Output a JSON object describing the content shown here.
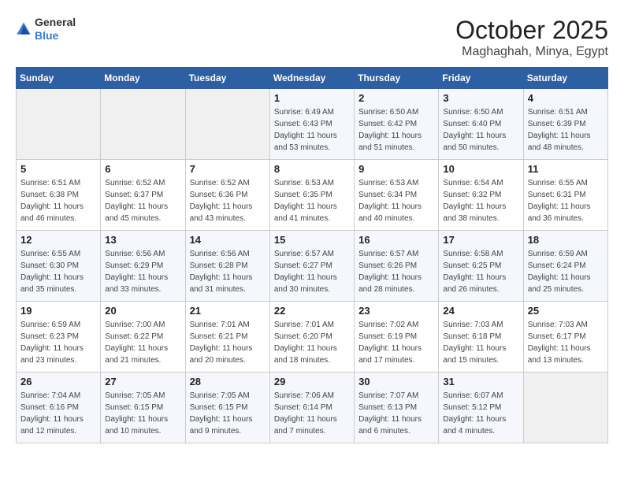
{
  "logo": {
    "text_general": "General",
    "text_blue": "Blue"
  },
  "title": {
    "month": "October 2025",
    "location": "Maghaghah, Minya, Egypt"
  },
  "days_of_week": [
    "Sunday",
    "Monday",
    "Tuesday",
    "Wednesday",
    "Thursday",
    "Friday",
    "Saturday"
  ],
  "weeks": [
    [
      {
        "day": "",
        "info": ""
      },
      {
        "day": "",
        "info": ""
      },
      {
        "day": "",
        "info": ""
      },
      {
        "day": "1",
        "info": "Sunrise: 6:49 AM\nSunset: 6:43 PM\nDaylight: 11 hours\nand 53 minutes."
      },
      {
        "day": "2",
        "info": "Sunrise: 6:50 AM\nSunset: 6:42 PM\nDaylight: 11 hours\nand 51 minutes."
      },
      {
        "day": "3",
        "info": "Sunrise: 6:50 AM\nSunset: 6:40 PM\nDaylight: 11 hours\nand 50 minutes."
      },
      {
        "day": "4",
        "info": "Sunrise: 6:51 AM\nSunset: 6:39 PM\nDaylight: 11 hours\nand 48 minutes."
      }
    ],
    [
      {
        "day": "5",
        "info": "Sunrise: 6:51 AM\nSunset: 6:38 PM\nDaylight: 11 hours\nand 46 minutes."
      },
      {
        "day": "6",
        "info": "Sunrise: 6:52 AM\nSunset: 6:37 PM\nDaylight: 11 hours\nand 45 minutes."
      },
      {
        "day": "7",
        "info": "Sunrise: 6:52 AM\nSunset: 6:36 PM\nDaylight: 11 hours\nand 43 minutes."
      },
      {
        "day": "8",
        "info": "Sunrise: 6:53 AM\nSunset: 6:35 PM\nDaylight: 11 hours\nand 41 minutes."
      },
      {
        "day": "9",
        "info": "Sunrise: 6:53 AM\nSunset: 6:34 PM\nDaylight: 11 hours\nand 40 minutes."
      },
      {
        "day": "10",
        "info": "Sunrise: 6:54 AM\nSunset: 6:32 PM\nDaylight: 11 hours\nand 38 minutes."
      },
      {
        "day": "11",
        "info": "Sunrise: 6:55 AM\nSunset: 6:31 PM\nDaylight: 11 hours\nand 36 minutes."
      }
    ],
    [
      {
        "day": "12",
        "info": "Sunrise: 6:55 AM\nSunset: 6:30 PM\nDaylight: 11 hours\nand 35 minutes."
      },
      {
        "day": "13",
        "info": "Sunrise: 6:56 AM\nSunset: 6:29 PM\nDaylight: 11 hours\nand 33 minutes."
      },
      {
        "day": "14",
        "info": "Sunrise: 6:56 AM\nSunset: 6:28 PM\nDaylight: 11 hours\nand 31 minutes."
      },
      {
        "day": "15",
        "info": "Sunrise: 6:57 AM\nSunset: 6:27 PM\nDaylight: 11 hours\nand 30 minutes."
      },
      {
        "day": "16",
        "info": "Sunrise: 6:57 AM\nSunset: 6:26 PM\nDaylight: 11 hours\nand 28 minutes."
      },
      {
        "day": "17",
        "info": "Sunrise: 6:58 AM\nSunset: 6:25 PM\nDaylight: 11 hours\nand 26 minutes."
      },
      {
        "day": "18",
        "info": "Sunrise: 6:59 AM\nSunset: 6:24 PM\nDaylight: 11 hours\nand 25 minutes."
      }
    ],
    [
      {
        "day": "19",
        "info": "Sunrise: 6:59 AM\nSunset: 6:23 PM\nDaylight: 11 hours\nand 23 minutes."
      },
      {
        "day": "20",
        "info": "Sunrise: 7:00 AM\nSunset: 6:22 PM\nDaylight: 11 hours\nand 21 minutes."
      },
      {
        "day": "21",
        "info": "Sunrise: 7:01 AM\nSunset: 6:21 PM\nDaylight: 11 hours\nand 20 minutes."
      },
      {
        "day": "22",
        "info": "Sunrise: 7:01 AM\nSunset: 6:20 PM\nDaylight: 11 hours\nand 18 minutes."
      },
      {
        "day": "23",
        "info": "Sunrise: 7:02 AM\nSunset: 6:19 PM\nDaylight: 11 hours\nand 17 minutes."
      },
      {
        "day": "24",
        "info": "Sunrise: 7:03 AM\nSunset: 6:18 PM\nDaylight: 11 hours\nand 15 minutes."
      },
      {
        "day": "25",
        "info": "Sunrise: 7:03 AM\nSunset: 6:17 PM\nDaylight: 11 hours\nand 13 minutes."
      }
    ],
    [
      {
        "day": "26",
        "info": "Sunrise: 7:04 AM\nSunset: 6:16 PM\nDaylight: 11 hours\nand 12 minutes."
      },
      {
        "day": "27",
        "info": "Sunrise: 7:05 AM\nSunset: 6:15 PM\nDaylight: 11 hours\nand 10 minutes."
      },
      {
        "day": "28",
        "info": "Sunrise: 7:05 AM\nSunset: 6:15 PM\nDaylight: 11 hours\nand 9 minutes."
      },
      {
        "day": "29",
        "info": "Sunrise: 7:06 AM\nSunset: 6:14 PM\nDaylight: 11 hours\nand 7 minutes."
      },
      {
        "day": "30",
        "info": "Sunrise: 7:07 AM\nSunset: 6:13 PM\nDaylight: 11 hours\nand 6 minutes."
      },
      {
        "day": "31",
        "info": "Sunrise: 6:07 AM\nSunset: 5:12 PM\nDaylight: 11 hours\nand 4 minutes."
      },
      {
        "day": "",
        "info": ""
      }
    ]
  ]
}
